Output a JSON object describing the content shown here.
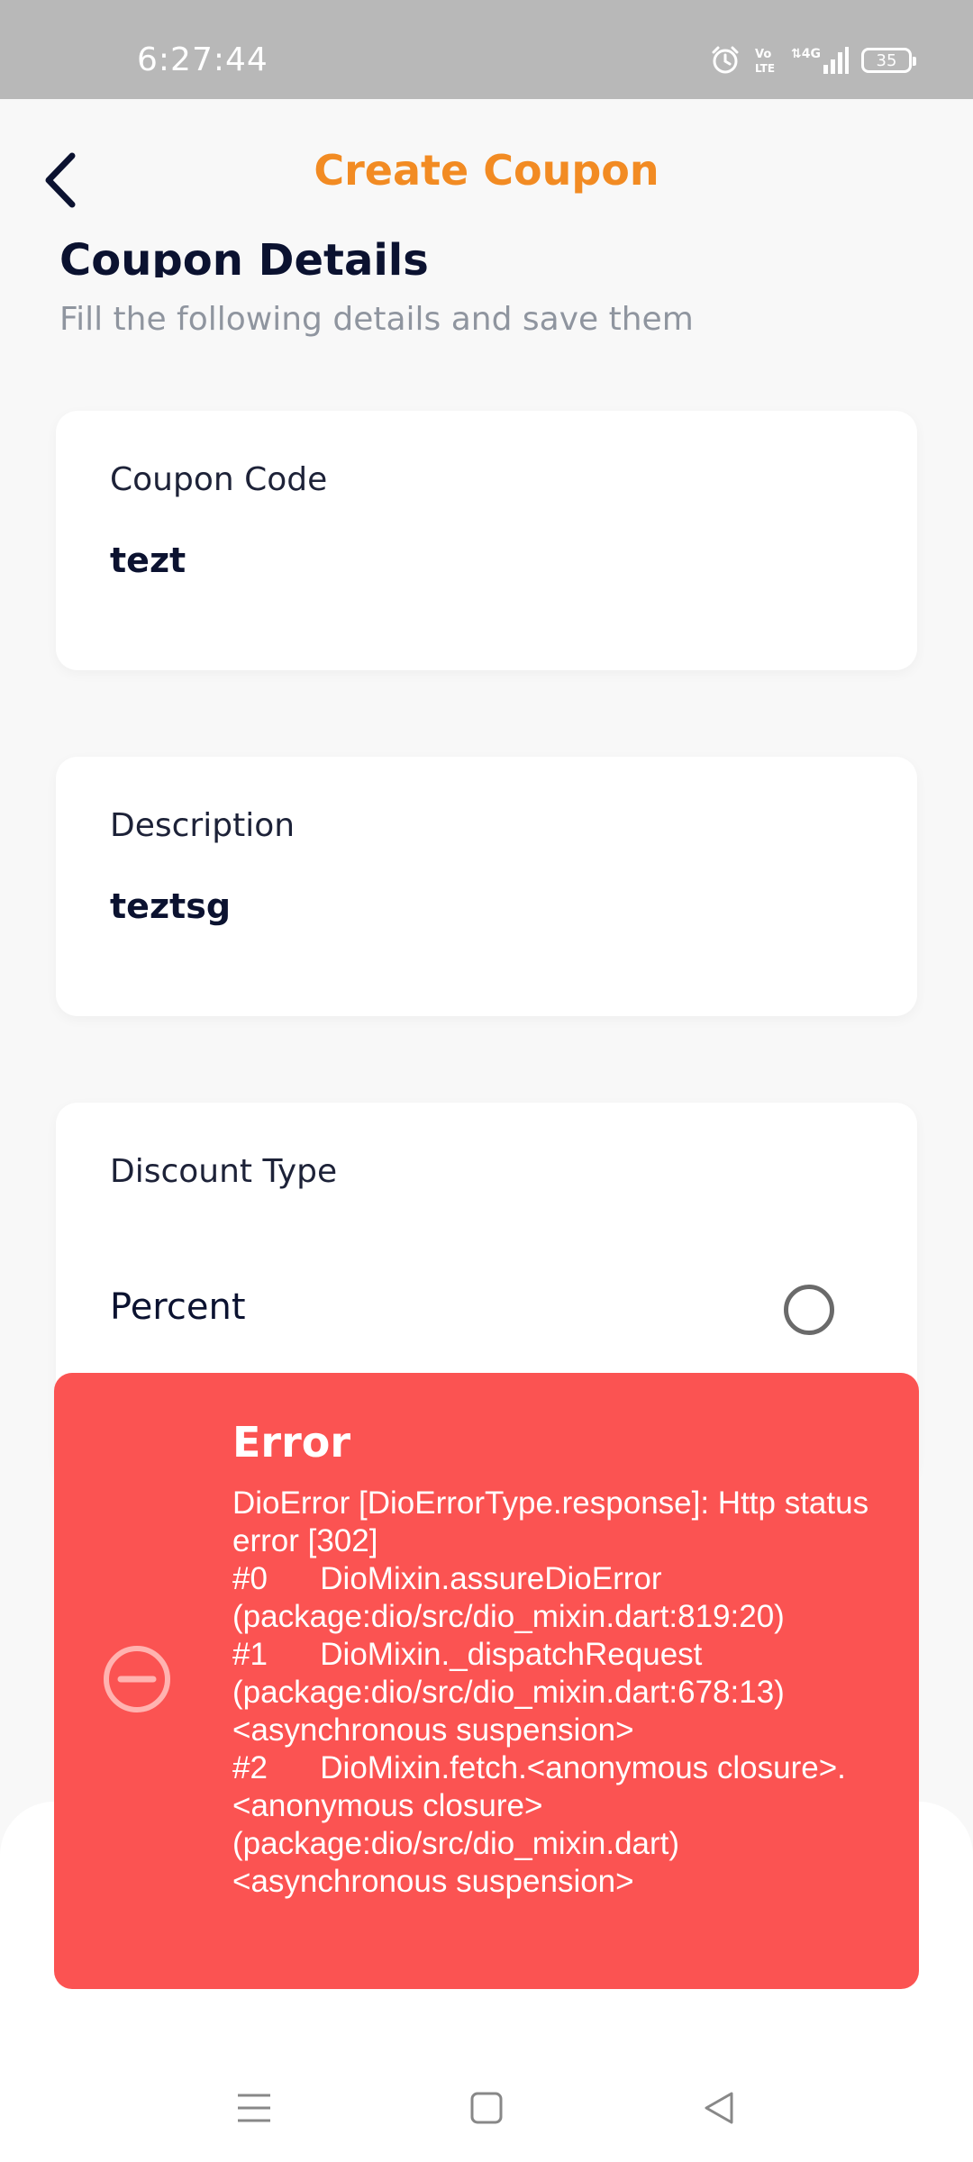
{
  "status_bar": {
    "time": "6:27:44",
    "battery": "35",
    "icons": [
      "alarm-icon",
      "volte-icon",
      "4g-signal-icon",
      "battery-icon"
    ]
  },
  "header": {
    "title": "Create Coupon",
    "back_icon": "chevron-left-icon"
  },
  "section": {
    "title": "Coupon Details",
    "subtitle": "Fill the following details and save them"
  },
  "fields": {
    "coupon_code": {
      "label": "Coupon Code",
      "value": "tezt"
    },
    "description": {
      "label": "Description",
      "value": "teztsg"
    },
    "discount_type": {
      "label": "Discount Type",
      "option": "Percent"
    }
  },
  "error": {
    "title": "Error",
    "message": "DioError [DioErrorType.response]: Http status error [302]\n#0      DioMixin.assureDioError (package:dio/src/dio_mixin.dart:819:20)\n#1      DioMixin._dispatchRequest (package:dio/src/dio_mixin.dart:678:13)\n<asynchronous suspension>\n#2      DioMixin.fetch.<anonymous closure>.<anonymous closure> (package:dio/src/dio_mixin.dart)\n<asynchronous suspension>",
    "icon": "minus-circle-icon"
  },
  "colors": {
    "accent": "#f28b23",
    "error": "#fb5352",
    "text_dark": "#0b1230"
  },
  "nav": {
    "icons": [
      "menu-icon",
      "home-square-icon",
      "back-triangle-icon"
    ]
  }
}
